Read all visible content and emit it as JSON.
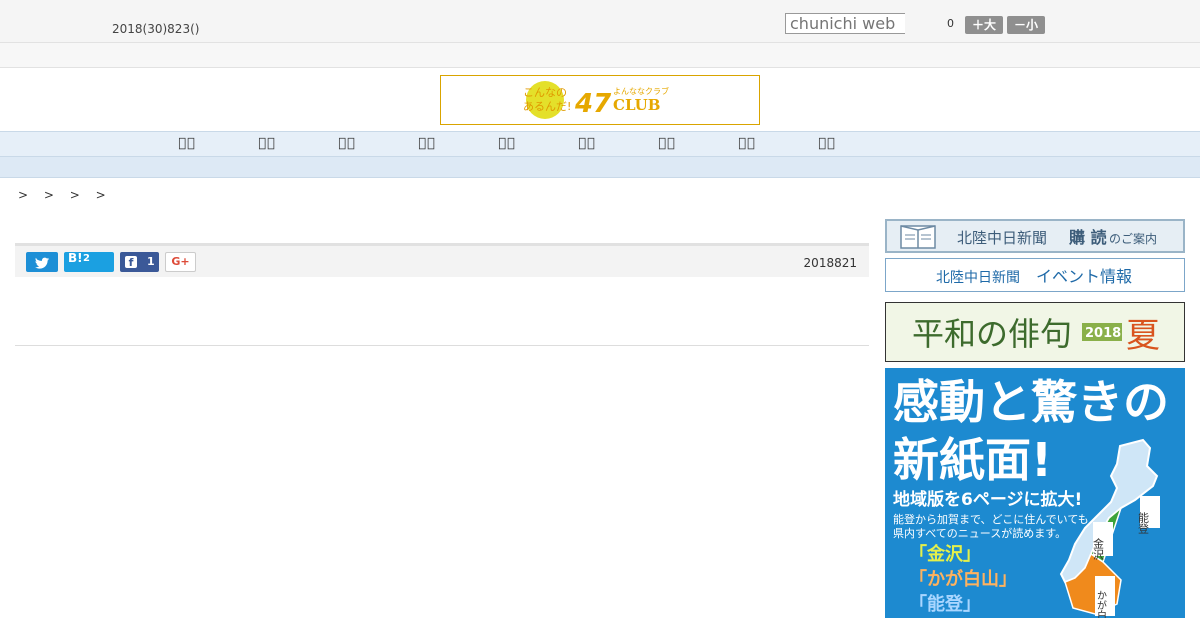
{
  "header": {
    "date": "2018(30)823()",
    "search_placeholder": "chunichi web",
    "counter": "0",
    "font_larger": "＋大",
    "font_smaller": "－小"
  },
  "banner": {
    "line1": "こんなの",
    "line2": "あるんだ!",
    "number": "47",
    "small": "よんななクラブ",
    "club": "CLUB"
  },
  "nav": {
    "items": [
      "\u0000\u0000",
      "\u0000\u0000",
      "\u0000\u0000",
      "\u0000\u0000",
      "\u0000\u0000",
      "\u0000\u0000",
      "\u0000\u0000",
      "\u0000\u0000",
      "\u0000\u0000"
    ]
  },
  "breadcrumb": "> > > >",
  "article": {
    "share": {
      "hatena_count": "2",
      "facebook_count": "1",
      "gplus_label": "G+",
      "hatena_label": "B!"
    },
    "date": "2018821"
  },
  "sidebar": {
    "ad_subscribe": {
      "main": "北陸中日新聞",
      "bold": "購 読",
      "tail": "のご案内"
    },
    "ad_event": {
      "paper": "北陸中日新聞",
      "text": "イベント情報"
    },
    "ad_haiku": {
      "title": "平和の俳句",
      "year": "2018",
      "season": "夏"
    },
    "ad_newpaper": {
      "headline1": "感動と驚きの",
      "headline2": "新紙面!",
      "sub": "地域版を6ページに拡大!",
      "body1": "能登から加賀まで、どこに住んでいても",
      "body2": "県内すべてのニュースが読めます。",
      "edition1": "「金沢」",
      "edition2": "「かが白山」",
      "edition3": "「能登」",
      "map_noto": "能登",
      "map_kanazawa": "金沢",
      "map_kaga": "かが白山"
    }
  }
}
